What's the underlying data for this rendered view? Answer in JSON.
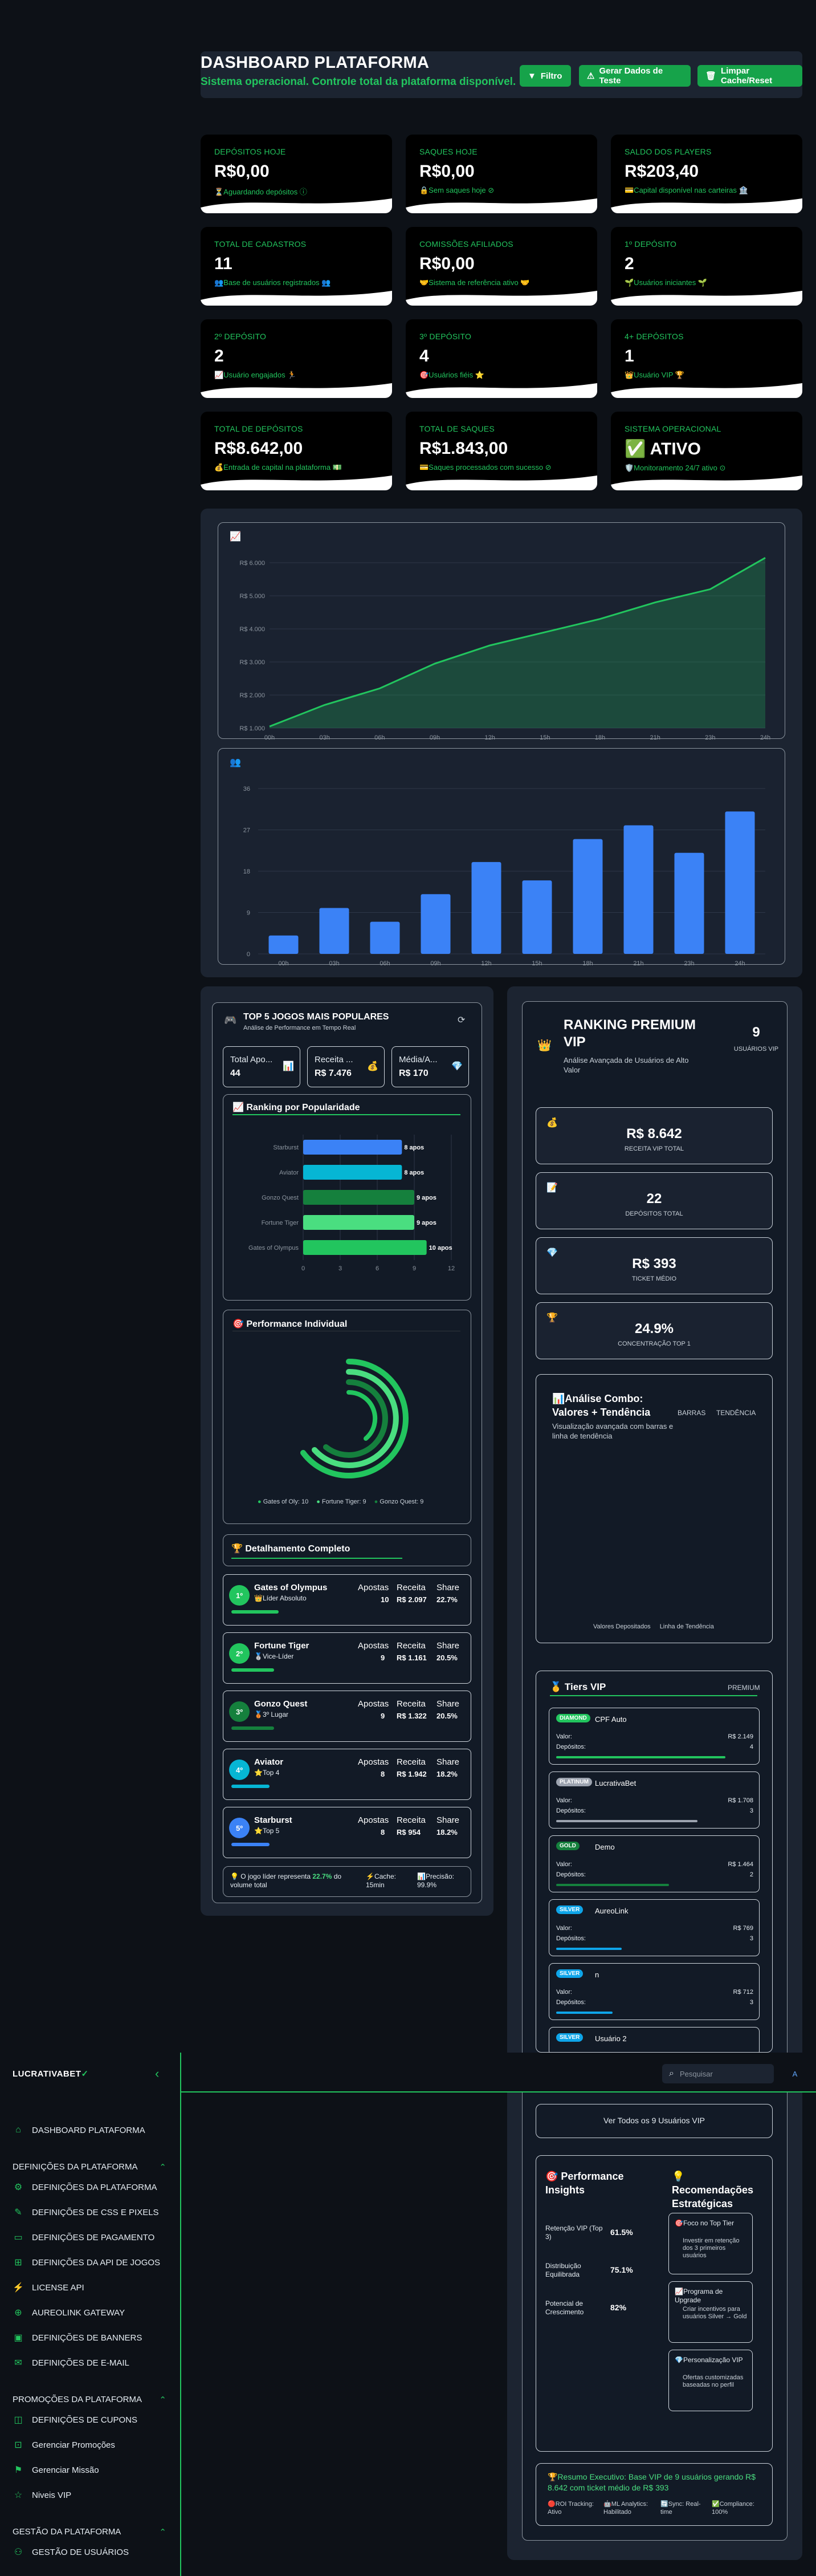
{
  "header": {
    "title": "DASHBOARD PLATAFORMA",
    "subtitle": "Sistema operacional. Controle total da plataforma disponível.",
    "buttons": {
      "filter": "Filtro",
      "generate": "Gerar Dados de Teste",
      "clear": "Limpar Cache/Reset"
    }
  },
  "cards": [
    {
      "label": "DEPÓSITOS HOJE",
      "value": "R$0,00",
      "note": "⏳Aguardando depósitos ⓘ"
    },
    {
      "label": "SAQUES HOJE",
      "value": "R$0,00",
      "note": "🔒Sem saques hoje ⊘"
    },
    {
      "label": "SALDO DOS PLAYERS",
      "value": "R$203,40",
      "note": "💳Capital disponível nas carteiras 🏦"
    },
    {
      "label": "TOTAL DE CADASTROS",
      "value": "11",
      "note": "👥Base de usuários registrados 👥"
    },
    {
      "label": "COMISSÕES AFILIADOS",
      "value": "R$0,00",
      "note": "🤝Sistema de referência ativo 🤝"
    },
    {
      "label": "1º DEPÓSITO",
      "value": "2",
      "note": "🌱Usuários iniciantes 🌱"
    },
    {
      "label": "2º DEPÓSITO",
      "value": "2",
      "note": "📈Usuário engajados 🏃"
    },
    {
      "label": "3º DEPÓSITO",
      "value": "4",
      "note": "🎯Usuários fiéis ⭐"
    },
    {
      "label": "4+ DEPÓSITOS",
      "value": "1",
      "note": "👑Usuário VIP 🏆"
    },
    {
      "label": "TOTAL DE DEPÓSITOS",
      "value": "R$8.642,00",
      "note": "💰Entrada de capital na plataforma 💵"
    },
    {
      "label": "TOTAL DE SAQUES",
      "value": "R$1.843,00",
      "note": "💳Saques processados com sucesso ⊘"
    },
    {
      "label": "SISTEMA OPERACIONAL",
      "value": "✅ ATIVO",
      "note": "🛡️Monitoramento 24/7 ativo ⊙"
    }
  ],
  "chart_data": [
    {
      "type": "area",
      "x": [
        "00h",
        "03h",
        "06h",
        "09h",
        "12h",
        "15h",
        "18h",
        "21h",
        "23h",
        "24h"
      ],
      "values": [
        1050,
        1700,
        2200,
        2950,
        3500,
        3900,
        4300,
        4800,
        5200,
        6150
      ],
      "yticks": [
        "R$ 1.000",
        "R$ 2.000",
        "R$ 3.000",
        "R$ 4.000",
        "R$ 5.000",
        "R$ 6.000"
      ],
      "ylim": [
        1000,
        6000
      ],
      "color": "#22c55e"
    },
    {
      "type": "bar",
      "categories": [
        "00h",
        "03h",
        "06h",
        "09h",
        "12h",
        "15h",
        "18h",
        "21h",
        "23h",
        "24h"
      ],
      "values": [
        4,
        10,
        7,
        13,
        20,
        16,
        25,
        28,
        22,
        31
      ],
      "yticks": [
        "0",
        "9",
        "18",
        "27",
        "36"
      ],
      "ylim": [
        0,
        36
      ],
      "color": "#3b82f6"
    },
    {
      "type": "bar",
      "categories": [
        "Starburst",
        "Aviator",
        "Gonzo Quest",
        "Fortune Tiger",
        "Gates of Olympus"
      ],
      "values": [
        8,
        8,
        9,
        9,
        10
      ],
      "data_labels": [
        "8 apos",
        "8 apos",
        "9 apos",
        "9 apos",
        "10 apos"
      ],
      "xticks": [
        "0",
        "3",
        "6",
        "9",
        "12"
      ],
      "xlim": [
        0,
        12
      ],
      "colors": [
        "#3b82f6",
        "#06b6d4",
        "#15803d",
        "#4ade80",
        "#22c55e"
      ]
    }
  ],
  "games": {
    "title": "TOP 5 JOGOS MAIS POPULARES",
    "subtitle": "Análise de Performance em Tempo Real",
    "stats": [
      {
        "label": "Total Apo...",
        "value": "44",
        "icon": "📊"
      },
      {
        "label": "Receita ...",
        "value": "R$ 7.476",
        "icon": "💰"
      },
      {
        "label": "Média/A...",
        "value": "R$ 170",
        "icon": "💎"
      }
    ],
    "ranking_title": "📈 Ranking por Popularidade",
    "performance_title": "🎯 Performance Individual",
    "legend": [
      "Gates of Oly: 10",
      "Fortune Tiger: 9",
      "Gonzo Quest: 9"
    ],
    "detail_title": "🏆 Detalhamento Completo",
    "col_labels": {
      "bets": "Apostas",
      "revenue": "Receita",
      "share": "Share"
    },
    "rows": [
      {
        "rank": "1º",
        "name": "Gates of Olympus",
        "tag": "👑Líder Absoluto",
        "bets": "10",
        "revenue": "R$ 2.097",
        "share": "22.7%",
        "color": "#22c55e"
      },
      {
        "rank": "2º",
        "name": "Fortune Tiger",
        "tag": "🥈Vice-Líder",
        "bets": "9",
        "revenue": "R$ 1.161",
        "share": "20.5%",
        "color": "#22c55e"
      },
      {
        "rank": "3º",
        "name": "Gonzo Quest",
        "tag": "🥉3º Lugar",
        "bets": "9",
        "revenue": "R$ 1.322",
        "share": "20.5%",
        "color": "#15803d"
      },
      {
        "rank": "4º",
        "name": "Aviator",
        "tag": "⭐Top 4",
        "bets": "8",
        "revenue": "R$ 1.942",
        "share": "18.2%",
        "color": "#06b6d4"
      },
      {
        "rank": "5º",
        "name": "Starburst",
        "tag": "⭐Top 5",
        "bets": "8",
        "revenue": "R$ 954",
        "share": "18.2%",
        "color": "#3b82f6"
      }
    ],
    "footer": {
      "lead": "💡 O jogo líder representa",
      "pct": "22.7%",
      "tail": "do volume total",
      "cache_label": "⚡Cache:",
      "cache_value": "15min",
      "precision_label": "📊Precisão:",
      "precision_value": "99.9%"
    }
  },
  "vip": {
    "title": "RANKING PREMIUM VIP",
    "subtitle": "Análise Avançada de Usuários de Alto Valor",
    "count": "9",
    "count_label": "USUÁRIOS VIP",
    "metrics": [
      {
        "icon": "💰",
        "value": "R$ 8.642",
        "label": "RECEITA VIP TOTAL"
      },
      {
        "icon": "📝",
        "value": "22",
        "label": "DEPÓSITOS TOTAL"
      },
      {
        "icon": "💎",
        "value": "R$ 393",
        "label": "TICKET MÉDIO"
      },
      {
        "icon": "🏆",
        "value": "24.9%",
        "label": "CONCENTRAÇÃO TOP 1"
      }
    ],
    "combo_title": "📊Análise Combo: Valores + Tendência",
    "combo_subtitle": "Visualização avançada com barras e linha de tendência",
    "combo_tabs": [
      "BARRAS",
      "TENDÊNCIA"
    ],
    "combo_legend": [
      "Valores Depositados",
      "Linha de Tendência"
    ],
    "tiers_title": "🥇 Tiers VIP",
    "tiers_badge": "PREMIUM",
    "tier_value_label": "Valor:",
    "tier_deposits_label": "Depósitos:",
    "users": [
      {
        "badge": "DIAMOND",
        "name": "CPF Auto",
        "value": "R$ 2.149",
        "deposits": "4",
        "fill": 0.9
      },
      {
        "badge": "PLATINUM",
        "name": "LucrativaBet",
        "value": "R$ 1.708",
        "deposits": "3",
        "fill": 0.75
      },
      {
        "badge": "GOLD",
        "name": "Demo",
        "value": "R$ 1.464",
        "deposits": "2",
        "fill": 0.6
      },
      {
        "badge": "SILVER",
        "name": "AureoLink",
        "value": "R$ 769",
        "deposits": "3",
        "fill": 0.35
      },
      {
        "badge": "SILVER",
        "name": "n",
        "value": "R$ 712",
        "deposits": "3",
        "fill": 0.3
      },
      {
        "badge": "SILVER",
        "name": "Usuário 2",
        "value": "",
        "deposits": "",
        "fill": 0.2
      }
    ],
    "view_all": "Ver Todos os 9 Usuários VIP",
    "insights_title": "🎯 Performance Insights",
    "insights": [
      {
        "label": "Retenção VIP (Top 3)",
        "value": "61.5%"
      },
      {
        "label": "Distribuição Equilibrada",
        "value": "75.1%"
      },
      {
        "label": "Potencial de Crescimento",
        "value": "82%"
      }
    ],
    "reco_title": "💡 Recomendações Estratégicas",
    "recos": [
      {
        "title": "🎯Foco no Top Tier",
        "text": "Investir em retenção dos 3 primeiros usuários"
      },
      {
        "title": "📈Programa de Upgrade",
        "text": "Criar incentivos para usuários Silver → Gold"
      },
      {
        "title": "💎Personalização VIP",
        "text": "Ofertas customizadas baseadas no perfil"
      }
    ],
    "summary": "🏆Resumo Executivo: Base VIP de 9 usuários gerando R$ 8.642 com ticket médio de R$ 393",
    "summary_tags": [
      "🔴ROI Tracking: Ativo",
      "🤖ML Analytics: Habilitado",
      "🔄Sync: Real-time",
      "✅Compliance: 100%"
    ]
  },
  "sidebar": {
    "logo": "LUCRATIVABET",
    "items": [
      {
        "label": "DASHBOARD PLATAFORMA",
        "icon": "home-icon"
      },
      {
        "label": "DEFINIÇÕES DA PLATAFORMA",
        "icon": "section"
      },
      {
        "label": "DEFINIÇÕES DA PLATAFORMA",
        "icon": "gear-icon"
      },
      {
        "label": "DEFINIÇÕES DE CSS E PIXELS",
        "icon": "brush-icon"
      },
      {
        "label": "DEFINIÇÕES DE PAGAMENTO",
        "icon": "card-icon"
      },
      {
        "label": "DEFINIÇÕES DA API DE JOGOS",
        "icon": "gamepad-icon"
      },
      {
        "label": "LICENSE API",
        "icon": "bolt-icon"
      },
      {
        "label": "AUREOLINK GATEWAY",
        "icon": "globe-icon"
      },
      {
        "label": "DEFINIÇÕES DE BANNERS",
        "icon": "image-icon"
      },
      {
        "label": "DEFINIÇÕES DE E-MAIL",
        "icon": "mail-icon"
      },
      {
        "label": "PROMOÇÕES DA PLATAFORMA",
        "icon": "section"
      },
      {
        "label": "DEFINIÇÕES DE CUPONS",
        "icon": "ticket-icon"
      },
      {
        "label": "Gerenciar Promoções",
        "icon": "gift-icon"
      },
      {
        "label": "Gerenciar Missão",
        "icon": "flag-icon"
      },
      {
        "label": "Niveis VIP",
        "icon": "star-icon"
      },
      {
        "label": "GESTÃO DA PLATAFORMA",
        "icon": "section"
      },
      {
        "label": "GESTÃO DE USUÁRIOS",
        "icon": "users-icon"
      }
    ]
  },
  "topbar": {
    "search_placeholder": "Pesquisar",
    "avatar": "A"
  }
}
